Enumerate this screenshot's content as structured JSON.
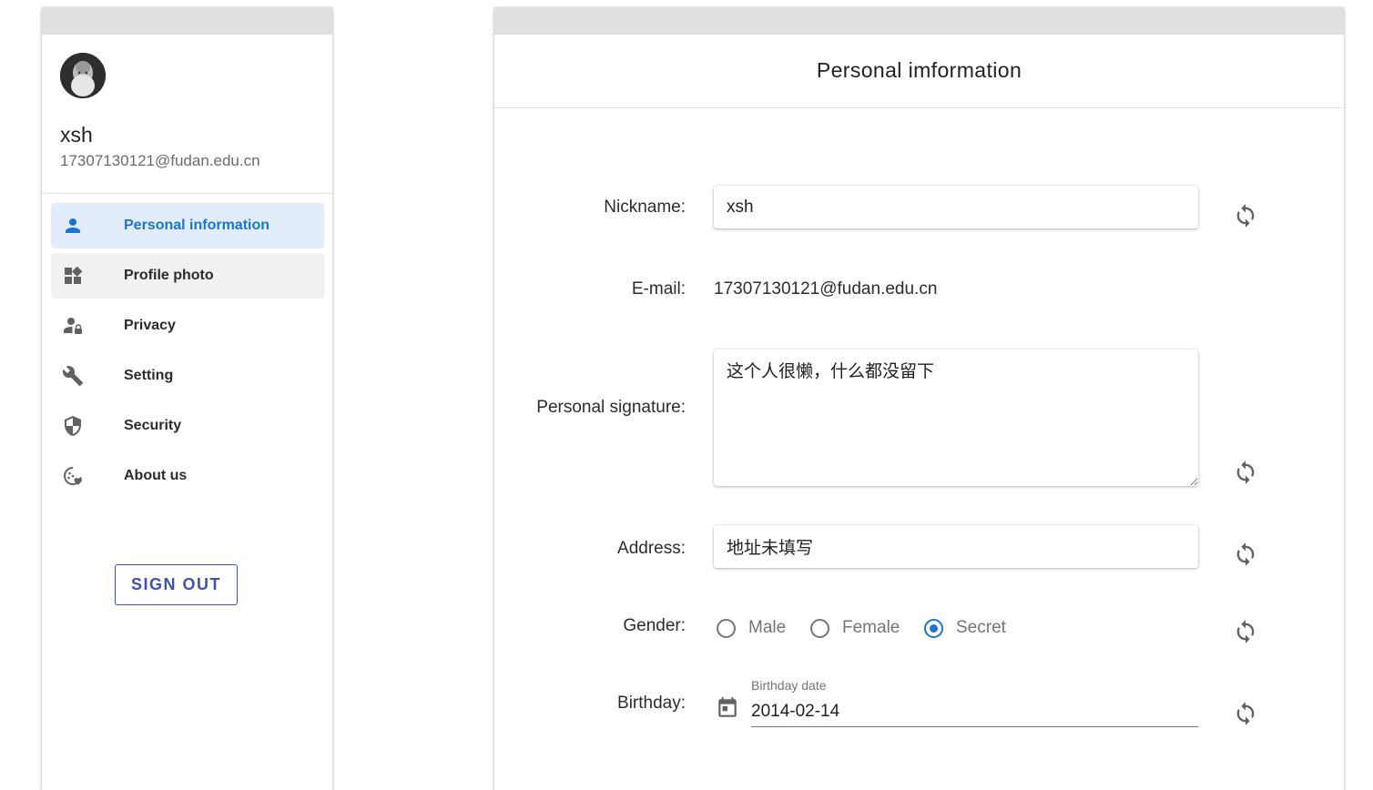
{
  "sidebar": {
    "user": {
      "name": "xsh",
      "email": "17307130121@fudan.edu.cn"
    },
    "items": [
      {
        "label": "Personal information",
        "icon": "person-icon",
        "active": true
      },
      {
        "label": "Profile photo",
        "icon": "widgets-icon"
      },
      {
        "label": "Privacy",
        "icon": "person-lock-icon"
      },
      {
        "label": "Setting",
        "icon": "wrench-icon"
      },
      {
        "label": "Security",
        "icon": "shield-icon"
      },
      {
        "label": "About us",
        "icon": "cookie-heart-icon"
      }
    ],
    "sign_out_label": "SIGN OUT"
  },
  "main": {
    "title": "Personal imformation",
    "form": {
      "nickname": {
        "label": "Nickname:",
        "value": "xsh"
      },
      "email": {
        "label": "E-mail:",
        "value": "17307130121@fudan.edu.cn"
      },
      "signature": {
        "label": "Personal signature:",
        "value": "这个人很懒，什么都没留下"
      },
      "address": {
        "label": "Address:",
        "value": "地址未填写"
      },
      "gender": {
        "label": "Gender:",
        "options": [
          "Male",
          "Female",
          "Secret"
        ],
        "selected": "Secret"
      },
      "birthday": {
        "label": "Birthday:",
        "caption": "Birthday date",
        "value": "2014-02-14"
      }
    },
    "refresh_icon": "sync-icon"
  },
  "colors": {
    "accent": "#1976d2",
    "button": "#3f51b5",
    "active_bg": "#e3edf9"
  }
}
